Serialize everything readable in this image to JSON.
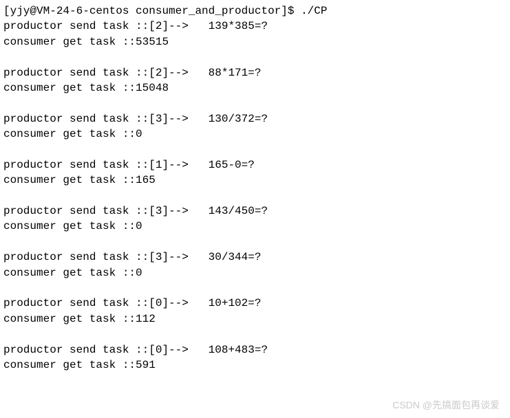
{
  "prompt": "[yjy@VM-24-6-centos consumer_and_productor]$ ./CP",
  "tasks": [
    {
      "send": "productor send task ::[2]-->   139*385=?",
      "get": "consumer get task ::53515"
    },
    {
      "send": "productor send task ::[2]-->   88*171=?",
      "get": "consumer get task ::15048"
    },
    {
      "send": "productor send task ::[3]-->   130/372=?",
      "get": "consumer get task ::0"
    },
    {
      "send": "productor send task ::[1]-->   165-0=?",
      "get": "consumer get task ::165"
    },
    {
      "send": "productor send task ::[3]-->   143/450=?",
      "get": "consumer get task ::0"
    },
    {
      "send": "productor send task ::[3]-->   30/344=?",
      "get": "consumer get task ::0"
    },
    {
      "send": "productor send task ::[0]-->   10+102=?",
      "get": "consumer get task ::112"
    },
    {
      "send": "productor send task ::[0]-->   108+483=?",
      "get": "consumer get task ::591"
    }
  ],
  "watermark": "CSDN @先搞面包再谈爱"
}
